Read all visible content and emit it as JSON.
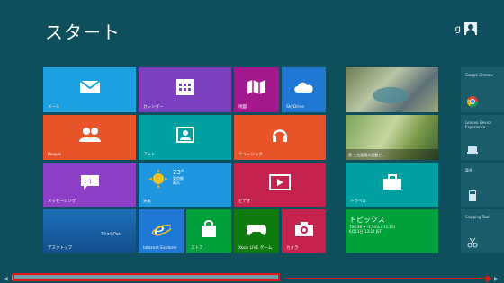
{
  "header": {
    "title": "スタート",
    "user_initial": "g"
  },
  "tiles": {
    "mail": "メール",
    "calendar": "カレンダー",
    "maps": "地図",
    "skydrive": "SkyDrive",
    "people": "People",
    "photos": "フォト",
    "music": "ミュージック",
    "messaging": "メッセージング",
    "weather": "天気",
    "video": "ビデオ",
    "desktop": "デスクトップ",
    "ie": "Internet Explorer",
    "store": "ストア",
    "xbox": "Xbox LIVE ゲーム",
    "camera": "カメラ",
    "travel": "トラベル"
  },
  "weather": {
    "temp": "23°",
    "city": "東京都",
    "cond": "晴天"
  },
  "news": {
    "text": "第 三位巡演の活動と..."
  },
  "finance": {
    "title": "トピックス",
    "line1": "708.38 ▼ -1.54% (-11.15)",
    "line2": "6月11日 13:22 JST"
  },
  "side": {
    "chrome": "Google Chrome",
    "lenovo": "Lenovo Device Experience",
    "clock": "電卓",
    "snipping": "Snipping Tool"
  },
  "desktop_brand": "ThinkPad"
}
